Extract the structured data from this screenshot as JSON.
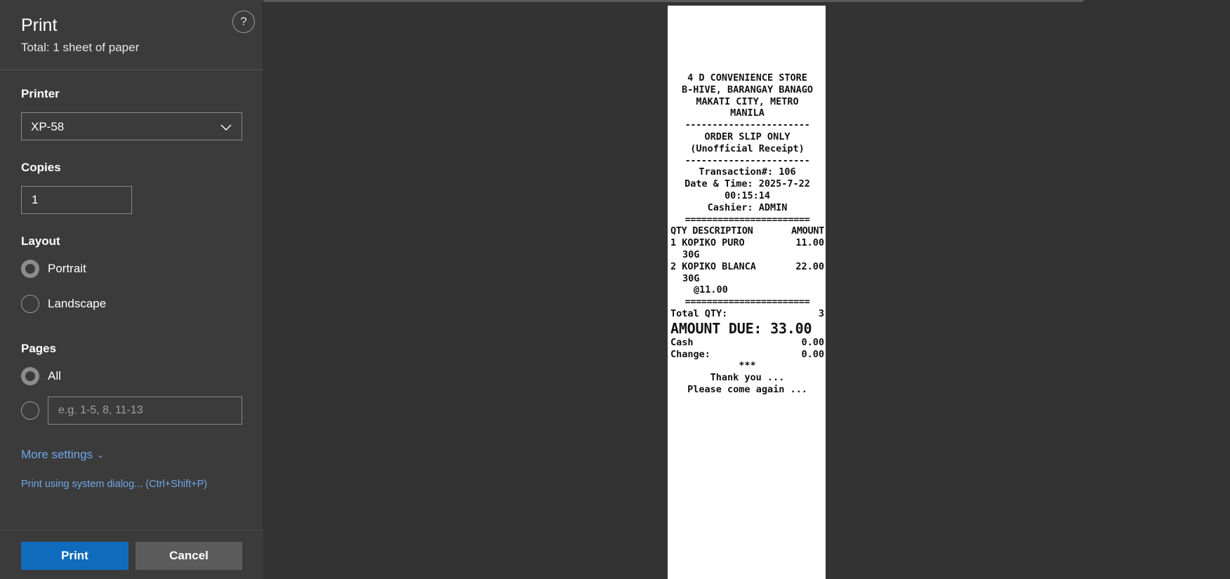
{
  "sidebar": {
    "title": "Print",
    "subtitle": "Total: 1 sheet of paper",
    "help_symbol": "?",
    "printer": {
      "label": "Printer",
      "value": "XP-58"
    },
    "copies": {
      "label": "Copies",
      "value": "1"
    },
    "layout": {
      "label": "Layout",
      "options": [
        "Portrait",
        "Landscape"
      ],
      "selected": "Portrait"
    },
    "pages": {
      "label": "Pages",
      "all_label": "All",
      "range_placeholder": "e.g. 1-5, 8, 11-13",
      "selected": "All"
    },
    "more_settings": "More settings",
    "system_dialog": "Print using system dialog... (Ctrl+Shift+P)",
    "print_button": "Print",
    "cancel_button": "Cancel"
  },
  "receipt": {
    "store_lines": [
      "4 D CONVENIENCE STORE",
      "B-HIVE, BARANGAY BANAGO",
      "MAKATI CITY, METRO",
      "MANILA"
    ],
    "dash_line": "-----------------------",
    "order_slip": "ORDER SLIP ONLY",
    "unofficial": "(Unofficial Receipt)",
    "transaction": "Transaction#: 106",
    "datetime_1": "Date & Time: 2025-7-22",
    "datetime_2": "00:15:14",
    "cashier": "Cashier: ADMIN",
    "equals_line": "=======================",
    "col_qty_desc": "QTY DESCRIPTION",
    "col_amount": "AMOUNT",
    "items": [
      {
        "line1_left": "1 KOPIKO PURO",
        "amount": "11.00",
        "line2": "30G",
        "unit_price": ""
      },
      {
        "line1_left": "2 KOPIKO BLANCA",
        "amount": "22.00",
        "line2": "30G",
        "unit_price": "@11.00"
      }
    ],
    "total_qty_label": "Total QTY:",
    "total_qty_value": "3",
    "amount_due": "AMOUNT DUE: 33.00",
    "cash_label": "Cash",
    "cash_value": "0.00",
    "change_label": "Change:",
    "change_value": "0.00",
    "stars": "***",
    "thank_you": "Thank you ...",
    "come_again": "Please come again ..."
  }
}
